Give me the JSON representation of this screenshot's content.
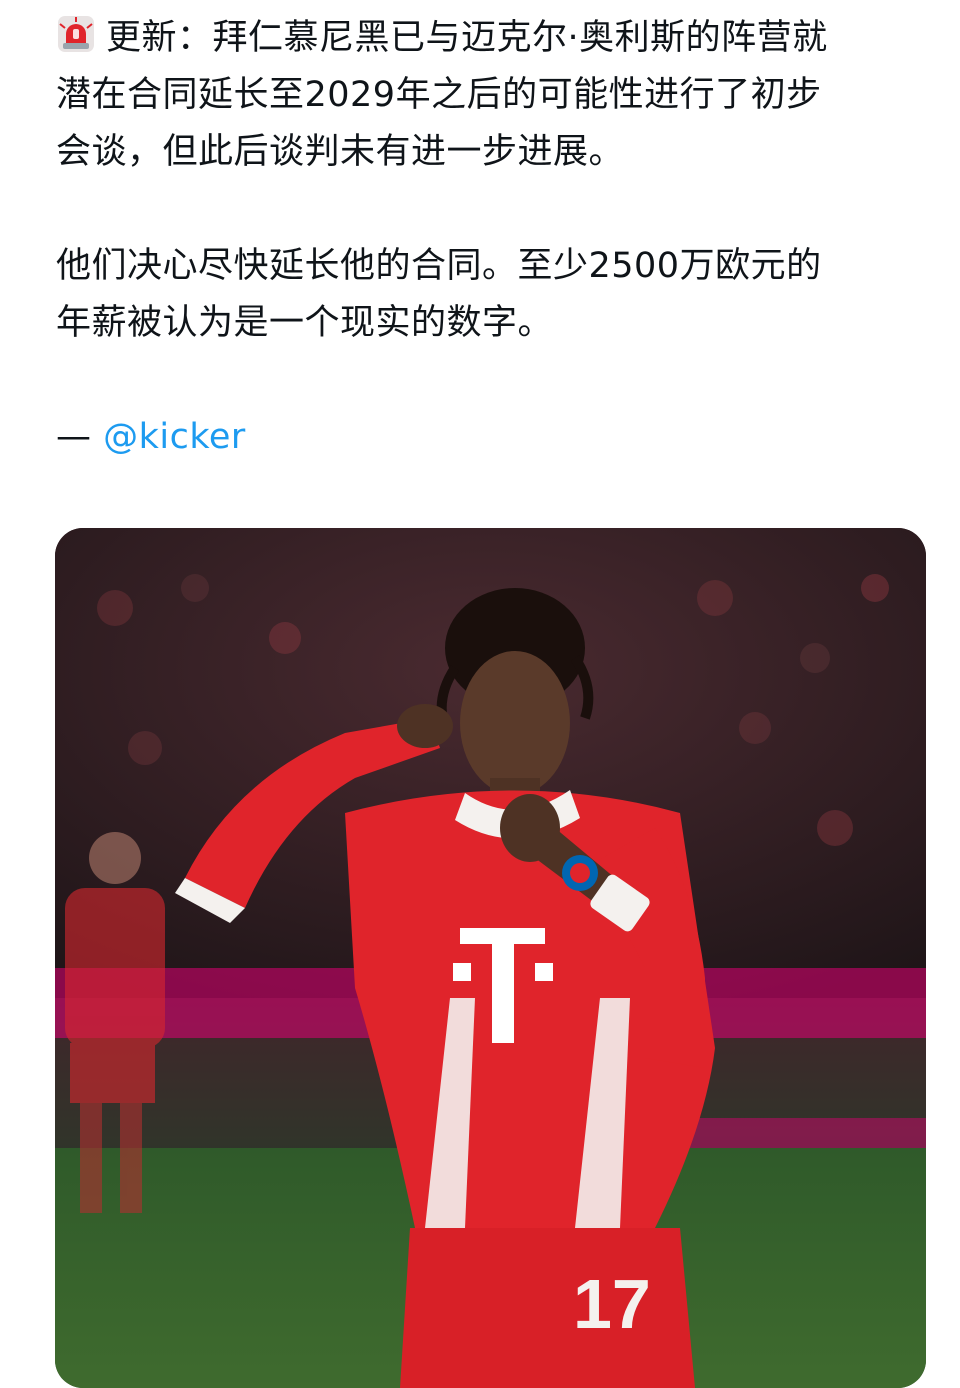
{
  "post": {
    "siren_icon": "rotating-light-icon",
    "line1": "更新：拜仁慕尼黑已与迈克尔·奥利斯的阵营就",
    "line2": "潜在合同延长至2029年之后的可能性进行了初步",
    "line3": "会谈，但此后谈判未有进一步进展。",
    "para2_line1": "他们决心尽快延长他的合同。至少2500万欧元的",
    "para2_line2": "年薪被认为是一个现实的数字。",
    "credit_dash": "—",
    "credit_handle": "@kicker"
  },
  "photo": {
    "jersey_number": "17",
    "sponsor_letter": "T",
    "colors": {
      "jersey_red": "#e0242b",
      "jersey_white": "#f4f1ee",
      "ad_board_magenta": "#e20074",
      "mention_blue": "#1d9bf0"
    }
  }
}
